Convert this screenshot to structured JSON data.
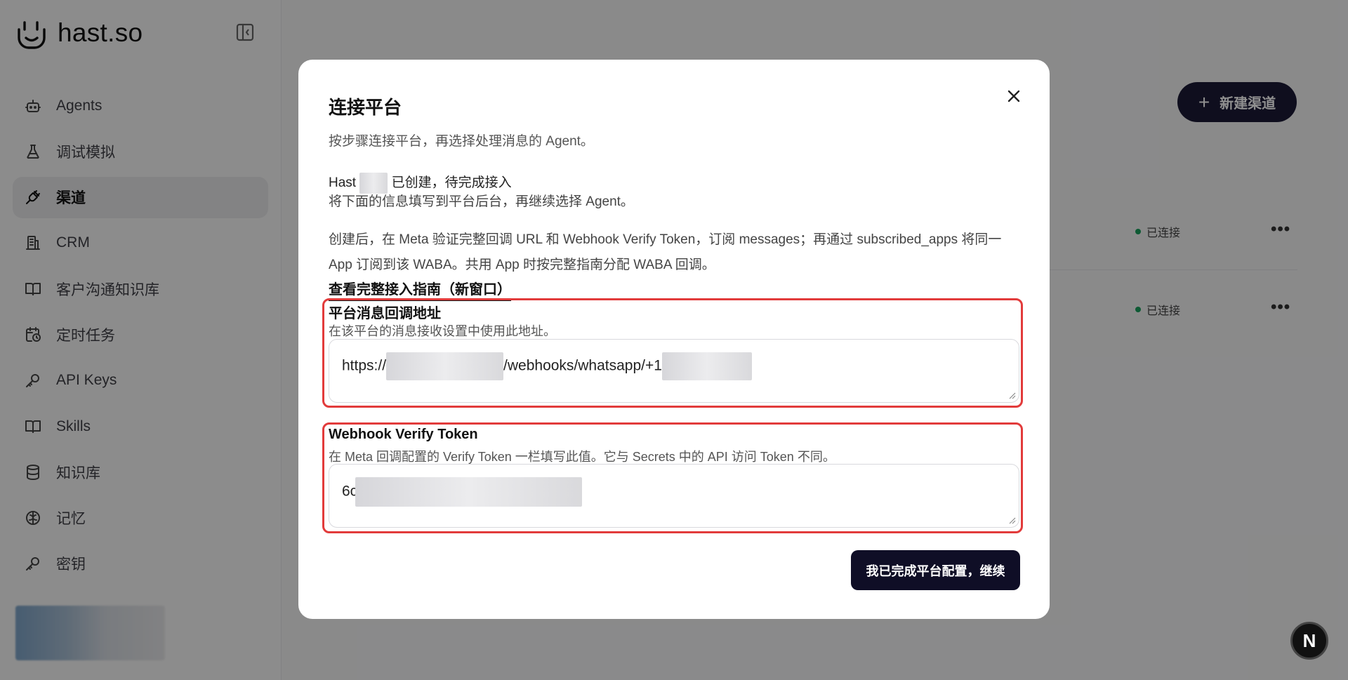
{
  "brand": {
    "name": "hast.so",
    "logo_icon": "smile-bag-icon"
  },
  "sidebar": {
    "items": [
      {
        "label": "Agents",
        "icon": "robot-icon"
      },
      {
        "label": "调试模拟",
        "icon": "flask-icon"
      },
      {
        "label": "渠道",
        "icon": "plug-icon",
        "active": true
      },
      {
        "label": "CRM",
        "icon": "building-icon"
      },
      {
        "label": "客户沟通知识库",
        "icon": "book-open-icon"
      },
      {
        "label": "定时任务",
        "icon": "calendar-clock-icon"
      },
      {
        "label": "API Keys",
        "icon": "key-icon"
      },
      {
        "label": "Skills",
        "icon": "book-open-icon"
      },
      {
        "label": "知识库",
        "icon": "database-icon"
      },
      {
        "label": "记忆",
        "icon": "brain-icon"
      },
      {
        "label": "密钥",
        "icon": "key-icon"
      }
    ]
  },
  "main": {
    "new_channel_label": "新建渠道",
    "rows": [
      {
        "status": "已连接"
      },
      {
        "status": "已连接"
      }
    ]
  },
  "modal": {
    "title": "连接平台",
    "subtitle": "按步骤连接平台，再选择处理消息的 Agent。",
    "created_prefix": "Hast",
    "created_suffix": "已创建，待完成接入",
    "fill_instruction": "将下面的信息填写到平台后台，再继续选择 Agent。",
    "meta_instruction": "创建后，在 Meta 验证完整回调 URL 和 Webhook Verify Token，订阅 messages；再通过 subscribed_apps 将同一 App 订阅到该 WABA。共用 App 时按完整指南分配 WABA 回调。",
    "guide_link": "查看完整接入指南（新窗口）",
    "callback": {
      "label": "平台消息回调地址",
      "help": "在该平台的消息接收设置中使用此地址。",
      "value_prefix": "https://",
      "value_mid": "/webhooks/whatsapp/+1"
    },
    "verify_token": {
      "label": "Webhook Verify Token",
      "help": "在 Meta 回调配置的 Verify Token 一栏填写此值。它与 Secrets 中的 API 访问 Token 不同。",
      "value_prefix": "6cc"
    },
    "continue_label": "我已完成平台配置，继续"
  },
  "badge": {
    "letter": "N"
  },
  "colors": {
    "accent": "#1b1a37",
    "highlight": "#e23b3b",
    "connected": "#19a15d"
  }
}
